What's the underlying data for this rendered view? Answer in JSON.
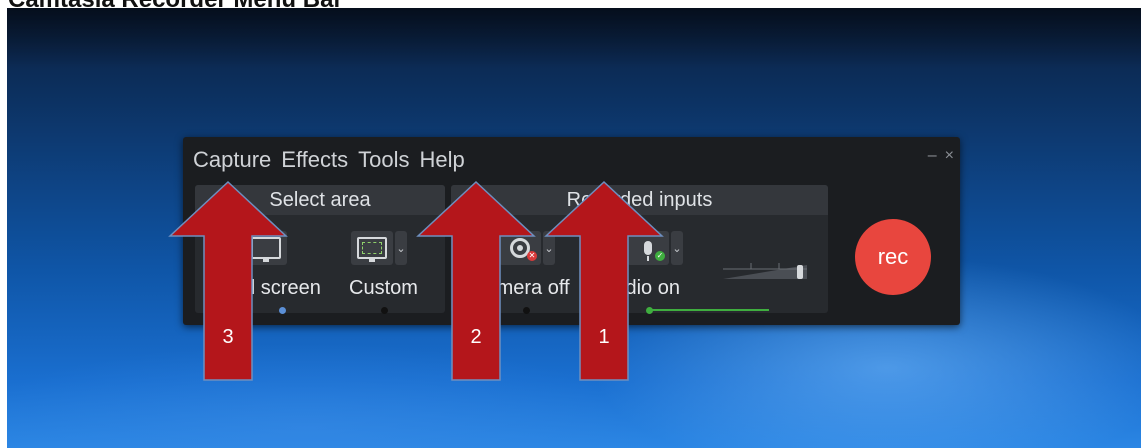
{
  "caption": {
    "text": "Camtasia Recorder Menu Bar"
  },
  "window": {
    "menu": [
      "Capture",
      "Effects",
      "Tools",
      "Help"
    ],
    "minimize": "–",
    "close": "×"
  },
  "select_area": {
    "header": "Select area",
    "options": [
      {
        "label": "Full screen",
        "icon": "monitor-icon"
      },
      {
        "label": "Custom",
        "icon": "monitor-dashed-icon"
      }
    ]
  },
  "recorded_inputs": {
    "header": "Recorded inputs",
    "options": [
      {
        "label": "Camera off",
        "icon": "webcam-off-icon"
      },
      {
        "label": "Audio on",
        "icon": "microphone-on-icon"
      }
    ],
    "audio_level": 0.95
  },
  "rec_button": {
    "label": "rec"
  },
  "colors": {
    "accent_green": "#3fae3f",
    "rec_red": "#e8463e",
    "arrow_red": "#b4161b"
  },
  "annotations": [
    {
      "number": "3"
    },
    {
      "number": "2"
    },
    {
      "number": "1"
    }
  ]
}
